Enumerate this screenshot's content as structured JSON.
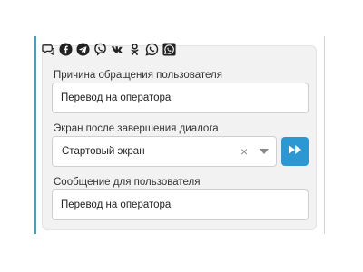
{
  "channels": {
    "icons": [
      "chat-bubbles-icon",
      "facebook-icon",
      "telegram-icon",
      "viber-icon",
      "vk-icon",
      "odnoklassniki-icon",
      "whatsapp-icon",
      "whatsapp-business-icon"
    ]
  },
  "form": {
    "reason_label": "Причина обращения пользователя",
    "reason_value": "Перевод на оператора",
    "screen_label": "Экран после завершения диалога",
    "screen_value": "Стартовый экран",
    "clear_symbol": "×",
    "message_label": "Сообщение для пользователя",
    "message_value": "Перевод на оператора"
  },
  "colors": {
    "accent": "#2c98d3",
    "frame": "#3ba3c8",
    "card_background": "#f2f2f2"
  }
}
